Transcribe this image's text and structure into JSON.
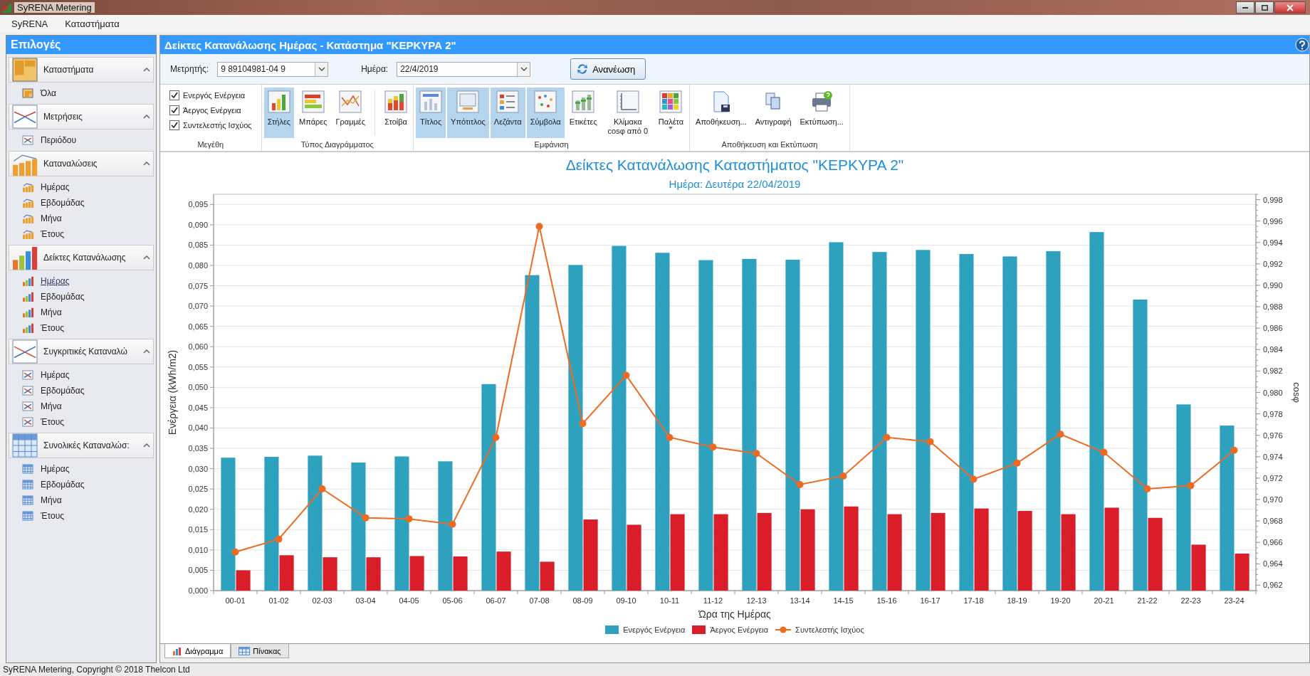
{
  "window": {
    "title": "SyRENA Metering"
  },
  "menu": [
    "SyRENA",
    "Καταστήματα"
  ],
  "sidebar": {
    "title": "Επιλογές",
    "groups": [
      {
        "label": "Καταστήματα",
        "expanded": true,
        "items": [
          {
            "label": "Όλα",
            "selected": false
          }
        ]
      },
      {
        "label": "Μετρήσεις",
        "expanded": true,
        "items": [
          {
            "label": "Περιόδου",
            "selected": false
          }
        ]
      },
      {
        "label": "Καταναλώσεις",
        "expanded": true,
        "items": [
          {
            "label": "Ημέρας",
            "selected": false
          },
          {
            "label": "Εβδομάδας",
            "selected": false
          },
          {
            "label": "Μήνα",
            "selected": false
          },
          {
            "label": "Έτους",
            "selected": false
          }
        ]
      },
      {
        "label": "Δείκτες Κατανάλωσης",
        "expanded": true,
        "items": [
          {
            "label": "Ημέρας",
            "selected": true
          },
          {
            "label": "Εβδομάδας",
            "selected": false
          },
          {
            "label": "Μήνα",
            "selected": false
          },
          {
            "label": "Έτους",
            "selected": false
          }
        ]
      },
      {
        "label": "Συγκριτικές Καταναλώ",
        "expanded": true,
        "items": [
          {
            "label": "Ημέρας",
            "selected": false
          },
          {
            "label": "Εβδομάδας",
            "selected": false
          },
          {
            "label": "Μήνα",
            "selected": false
          },
          {
            "label": "Έτους",
            "selected": false
          }
        ]
      },
      {
        "label": "Συνολικές Καταναλώσ:",
        "expanded": true,
        "items": [
          {
            "label": "Ημέρας",
            "selected": false
          },
          {
            "label": "Εβδομάδας",
            "selected": false
          },
          {
            "label": "Μήνα",
            "selected": false
          },
          {
            "label": "Έτους",
            "selected": false
          }
        ]
      }
    ]
  },
  "panel": {
    "title": "Δείκτες Κατανάλωσης Ημέρας - Κατάστημα \"ΚΕΡΚΥΡΑ 2\""
  },
  "filters": {
    "meter_label": "Μετρητής:",
    "meter_value": "9 89104981-04 9",
    "day_label": "Ημέρα:",
    "day_value": "22/4/2019",
    "refresh_button": "Ανανέωση"
  },
  "ribbon": {
    "groups": [
      {
        "label": "Μεγέθη",
        "kind": "checks",
        "items": [
          {
            "label": "Ενεργός Ενέργεια",
            "checked": true
          },
          {
            "label": "Άεργος Ενέργεια",
            "checked": true
          },
          {
            "label": "Συντελεστής Ισχύος",
            "checked": true
          }
        ]
      },
      {
        "label": "Τύπος Διαγράμματος",
        "kind": "choices",
        "items": [
          {
            "label": "Στήλες",
            "selected": true
          },
          {
            "label": "Μπάρες",
            "selected": false
          },
          {
            "label": "Γραμμές",
            "selected": false
          },
          {
            "label": "Στοίβα",
            "selected": false
          }
        ]
      },
      {
        "label": "Εμφάνιση",
        "kind": "toggles",
        "items": [
          {
            "label": "Τίτλος",
            "on": true
          },
          {
            "label": "Υπότιτλος",
            "on": true
          },
          {
            "label": "Λεζάντα",
            "on": true
          },
          {
            "label": "Σύμβολα",
            "on": true
          },
          {
            "label": "Ετικέτες",
            "on": false
          },
          {
            "label": "Κλίμακα cosφ από 0",
            "on": false
          },
          {
            "label": "Παλέτα",
            "on": false,
            "dropdown": true
          }
        ]
      },
      {
        "label": "Αποθήκευση και Εκτύπωση",
        "kind": "actions",
        "items": [
          {
            "label": "Αποθήκευση..."
          },
          {
            "label": "Αντιγραφή"
          },
          {
            "label": "Εκτύπωση..."
          }
        ]
      }
    ]
  },
  "chart": {
    "subtitle": "Ημέρα: Δευτέρα 22/04/2019",
    "chart_data": {
      "type": "bar",
      "title": "Δείκτες Κατανάλωσης Καταστήματος \"ΚΕΡΚΥΡΑ 2\"",
      "xlabel": "Ώρα της Ημέρας",
      "ylabel": "Ενέργεια (kWh/m2)",
      "y2label": "cosφ",
      "categories": [
        "00-01",
        "01-02",
        "02-03",
        "03-04",
        "04-05",
        "05-06",
        "06-07",
        "07-08",
        "08-09",
        "09-10",
        "10-11",
        "11-12",
        "12-13",
        "13-14",
        "14-15",
        "15-16",
        "16-17",
        "17-18",
        "18-19",
        "19-20",
        "20-21",
        "21-22",
        "22-23",
        "23-24"
      ],
      "series": [
        {
          "name": "Ενεργός Ενέργεια",
          "color": "#2ea1bf",
          "type": "bar",
          "values": [
            0.0327,
            0.0329,
            0.0332,
            0.0315,
            0.033,
            0.0318,
            0.0508,
            0.0776,
            0.0801,
            0.0848,
            0.0831,
            0.0813,
            0.0816,
            0.0814,
            0.0857,
            0.0833,
            0.0838,
            0.0828,
            0.0822,
            0.0835,
            0.0882,
            0.0716,
            0.0458,
            0.0406
          ]
        },
        {
          "name": "Άεργος Ενέργεια",
          "color": "#d91e2a",
          "type": "bar",
          "values": [
            0.005,
            0.0087,
            0.0082,
            0.0082,
            0.0085,
            0.0084,
            0.0096,
            0.0071,
            0.0175,
            0.0162,
            0.0188,
            0.0188,
            0.0191,
            0.02,
            0.0207,
            0.0188,
            0.0191,
            0.0202,
            0.0196,
            0.0188,
            0.0204,
            0.0179,
            0.0113,
            0.0091
          ]
        },
        {
          "name": "Συντελεστής Ισχύος",
          "color": "#ee6a22",
          "type": "line",
          "axis": "y2",
          "marker": "circle",
          "values": [
            0.9651,
            0.9663,
            0.971,
            0.9683,
            0.9682,
            0.9677,
            0.9758,
            0.9955,
            0.9771,
            0.9816,
            0.9758,
            0.9749,
            0.9743,
            0.9714,
            0.9722,
            0.9758,
            0.9754,
            0.9719,
            0.9734,
            0.9761,
            0.9744,
            0.971,
            0.9713,
            0.9746
          ]
        }
      ],
      "grid": true,
      "ylim": [
        0,
        0.0975
      ],
      "yticks": [
        {
          "value": 0,
          "label": "0,000"
        },
        {
          "value": 0.005,
          "label": "0,005"
        },
        {
          "value": 0.01,
          "label": "0,010"
        },
        {
          "value": 0.015,
          "label": "0,015"
        },
        {
          "value": 0.02,
          "label": "0,020"
        },
        {
          "value": 0.025,
          "label": "0,025"
        },
        {
          "value": 0.03,
          "label": "0,030"
        },
        {
          "value": 0.035,
          "label": "0,035"
        },
        {
          "value": 0.04,
          "label": "0,040"
        },
        {
          "value": 0.045,
          "label": "0,045"
        },
        {
          "value": 0.05,
          "label": "0,050"
        },
        {
          "value": 0.055,
          "label": "0,055"
        },
        {
          "value": 0.06,
          "label": "0,060"
        },
        {
          "value": 0.065,
          "label": "0,065"
        },
        {
          "value": 0.07,
          "label": "0,070"
        },
        {
          "value": 0.075,
          "label": "0,075"
        },
        {
          "value": 0.08,
          "label": "0,080"
        },
        {
          "value": 0.085,
          "label": "0,085"
        },
        {
          "value": 0.09,
          "label": "0,090"
        },
        {
          "value": 0.095,
          "label": "0,095"
        }
      ],
      "y2lim": [
        0.9615,
        0.9985
      ],
      "y2ticks": [
        {
          "value": 0.962,
          "label": "0,962"
        },
        {
          "value": 0.964,
          "label": "0,964"
        },
        {
          "value": 0.966,
          "label": "0,966"
        },
        {
          "value": 0.968,
          "label": "0,968"
        },
        {
          "value": 0.97,
          "label": "0,970"
        },
        {
          "value": 0.972,
          "label": "0,972"
        },
        {
          "value": 0.974,
          "label": "0,974"
        },
        {
          "value": 0.976,
          "label": "0,976"
        },
        {
          "value": 0.978,
          "label": "0,978"
        },
        {
          "value": 0.98,
          "label": "0,980"
        },
        {
          "value": 0.982,
          "label": "0,982"
        },
        {
          "value": 0.984,
          "label": "0,984"
        },
        {
          "value": 0.986,
          "label": "0,986"
        },
        {
          "value": 0.988,
          "label": "0,988"
        },
        {
          "value": 0.99,
          "label": "0,990"
        },
        {
          "value": 0.992,
          "label": "0,992"
        },
        {
          "value": 0.994,
          "label": "0,994"
        },
        {
          "value": 0.996,
          "label": "0,996"
        },
        {
          "value": 0.998,
          "label": "0,998"
        }
      ]
    }
  },
  "bottom_tabs": [
    {
      "label": "Διάγραμμα",
      "selected": true
    },
    {
      "label": "Πίνακας",
      "selected": false
    }
  ],
  "status_bar": "SyRENA Metering, Copyright © 2018 Thelcon Ltd"
}
